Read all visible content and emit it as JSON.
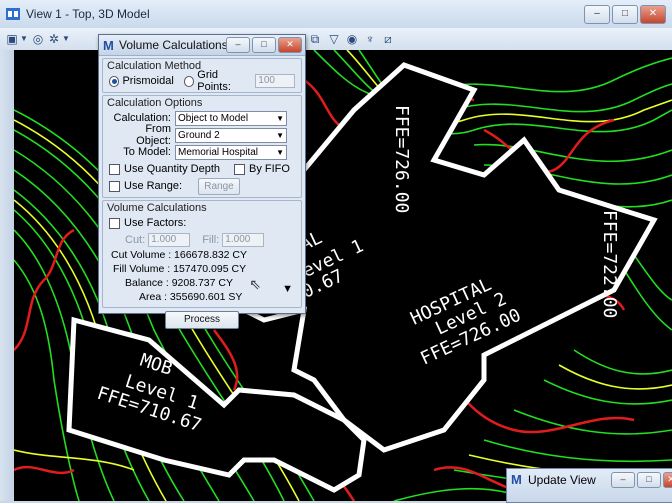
{
  "main_window": {
    "title": "View 1 - Top, 3D Model",
    "buttons": {
      "minimize": "–",
      "maximize": "□",
      "close": "✕"
    }
  },
  "toolbar": {
    "icons": [
      "view-attributes-icon",
      "dropdown-icon",
      "rotate-view-icon",
      "display-style-icon",
      "dropdown-icon",
      "fit-view-icon",
      "clip-volume-icon",
      "camera-icon",
      "render-icon",
      "element-display-icon"
    ]
  },
  "plan": {
    "labels": {
      "ffe_726_top": "FFE=726.00",
      "ffe_722": "FFE=722.00",
      "hospital_1_line1": "ITAL",
      "hospital_1_line2": "Level 1",
      "hospital_1_line3": "=710.67",
      "hospital_2_line1": "HOSPITAL",
      "hospital_2_line2": "Level 2",
      "hospital_2_line3": "FFE=726.00",
      "mob_line1": "MOB",
      "mob_line2": "Level 1",
      "mob_line3": "FFE=710.67"
    },
    "colors": {
      "contour": "#22dd22",
      "contour_alt": "#e8ff2a",
      "boundary": "#e01c1c",
      "pad_outline": "#ffffff",
      "background": "#000000"
    }
  },
  "dialog": {
    "title": "Volume Calculations",
    "method": {
      "title": "Calculation Method",
      "prismoidal_label": "Prismoidal",
      "prismoidal_selected": true,
      "grid_label": "Grid Points:",
      "grid_value": "100"
    },
    "options": {
      "title": "Calculation Options",
      "calculation_label": "Calculation:",
      "calculation_value": "Object to Model",
      "from_label": "From Object:",
      "from_value": "Ground 2",
      "to_label": "To Model:",
      "to_value": "Memorial Hospital",
      "quantity_depth_label": "Use Quantity Depth",
      "by_fifo_label": "By FIFO",
      "use_range_label": "Use Range:",
      "range_button": "Range"
    },
    "volume": {
      "title": "Volume Calculations",
      "use_factors_label": "Use Factors:",
      "cut_label": "Cut:",
      "cut_value": "1.000",
      "fill_label": "Fill:",
      "fill_value": "1.000",
      "cut_volume": "Cut Volume : 166678.832 CY",
      "fill_volume": "Fill Volume : 157470.095 CY",
      "balance": "Balance : 9208.737 CY",
      "area": "Area : 355690.601 SY"
    },
    "process_button": "Process"
  },
  "update_view": {
    "title": "Update View"
  }
}
